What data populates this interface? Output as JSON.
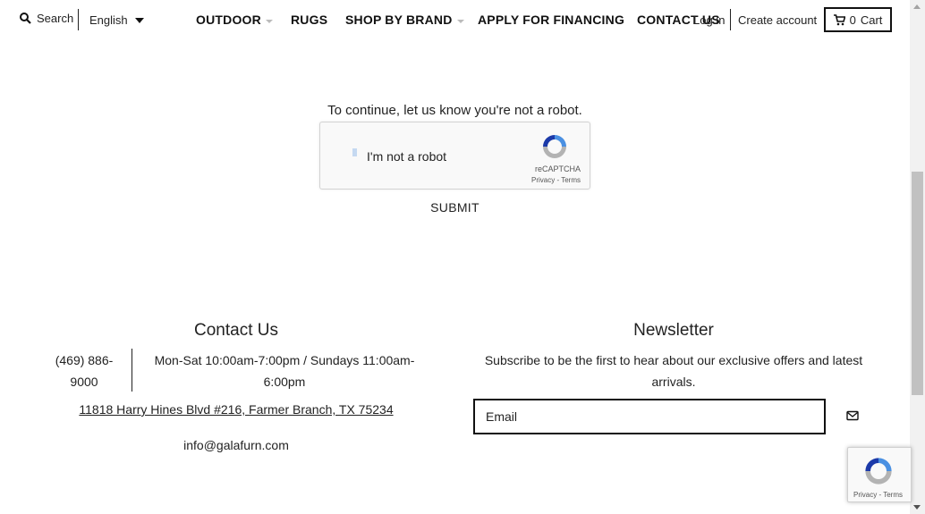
{
  "header": {
    "search_label": "Search",
    "language": "English",
    "nav": [
      {
        "label": "OUTDOOR",
        "has_dropdown": true
      },
      {
        "label": "RUGS",
        "has_dropdown": false
      },
      {
        "label": "SHOP BY BRAND",
        "has_dropdown": true
      },
      {
        "label": "APPLY FOR FINANCING",
        "has_dropdown": false
      },
      {
        "label": "CONTACT US",
        "has_dropdown": false
      }
    ],
    "login": "Log in",
    "create_account": "Create account",
    "cart_count": "0",
    "cart_label": "Cart"
  },
  "captcha": {
    "prompt": "To continue, let us know you're not a robot.",
    "checkbox_label": "I'm not a robot",
    "brand": "reCAPTCHA",
    "privacy": "Privacy",
    "terms": "Terms",
    "submit": "SUBMIT"
  },
  "footer": {
    "contact_title": "Contact Us",
    "phone": "(469) 886-9000",
    "hours": "Mon-Sat 10:00am-7:00pm / Sundays 11:00am-6:00pm",
    "address": "11818 Harry Hines Blvd #216, Farmer Branch, TX 75234",
    "email": "info@galafurn.com",
    "newsletter_title": "Newsletter",
    "newsletter_desc": "Subscribe to be the first to hear about our exclusive offers and latest arrivals.",
    "email_placeholder": "Email"
  },
  "badge": {
    "privacy": "Privacy",
    "terms": "Terms"
  },
  "colors": {
    "recaptcha_blue": "#4a90e2",
    "recaptcha_grey": "#b3b3b3",
    "recaptcha_darkblue": "#1c3aa9"
  }
}
